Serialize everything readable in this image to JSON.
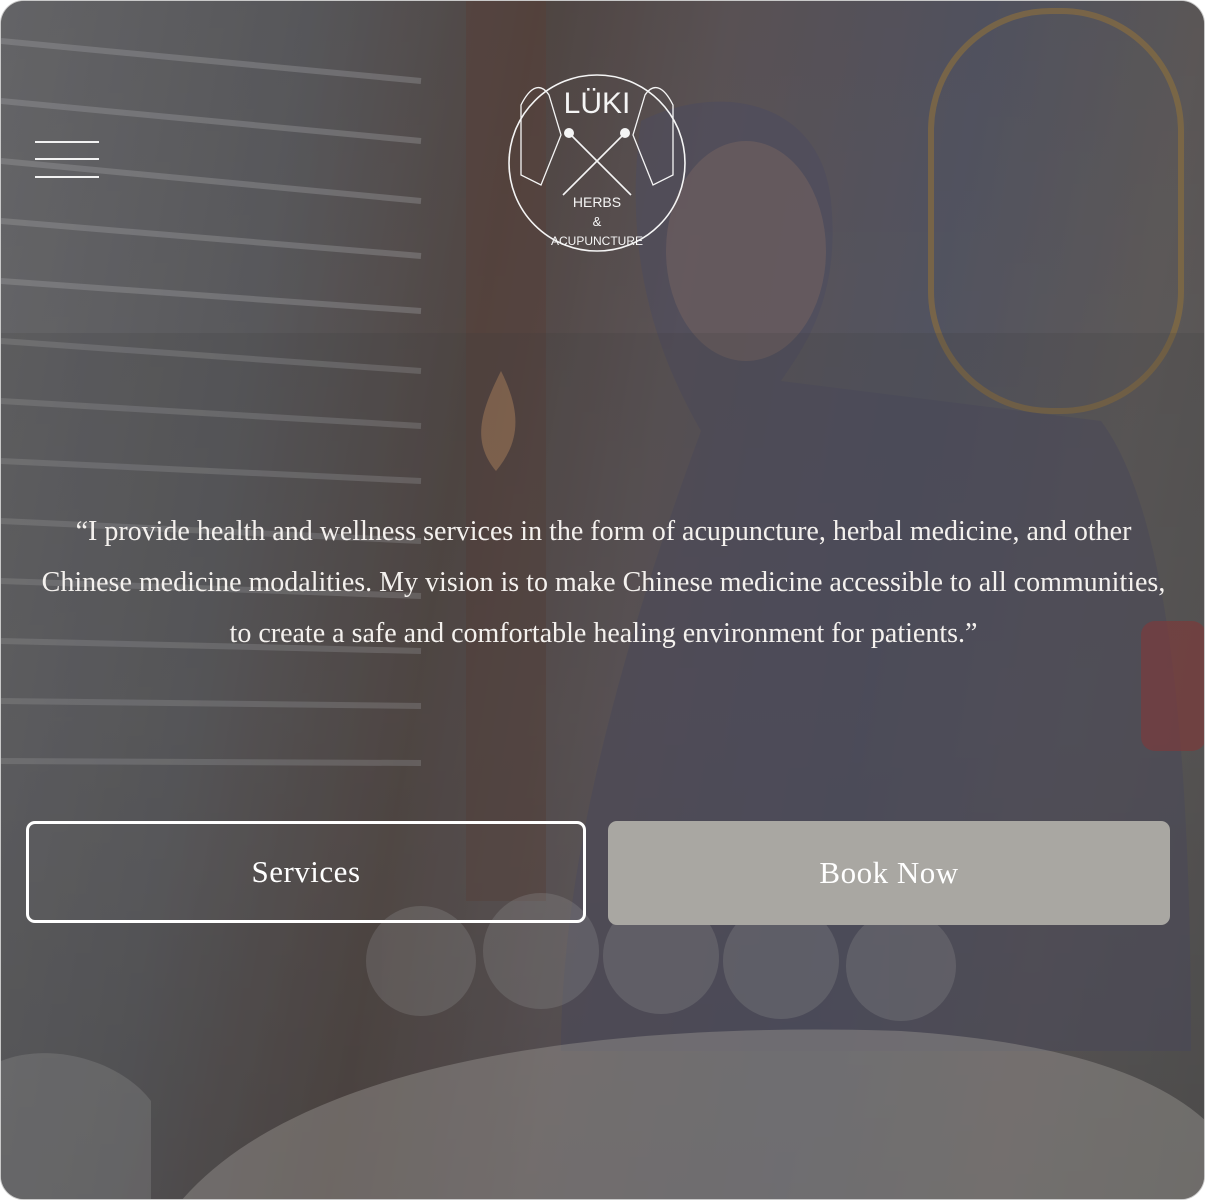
{
  "brand": {
    "name": "LÜKI",
    "line1": "HERBS",
    "line2": "&",
    "line3": "ACUPUNCTURE"
  },
  "nav": {
    "menu_icon": "hamburger-menu-icon"
  },
  "hero": {
    "quote": "“I provide health and wellness services in the form of acupuncture, herbal medicine, and other Chinese medicine modalities. My vision is to make Chinese medicine accessible to all communities, to create a safe and comfortable healing environment for patients.”"
  },
  "actions": {
    "services_label": "Services",
    "book_label": "Book Now"
  },
  "colors": {
    "text": "#f4f1ee",
    "book_button_bg": "#a9a7a2",
    "outline": "#ffffff"
  }
}
